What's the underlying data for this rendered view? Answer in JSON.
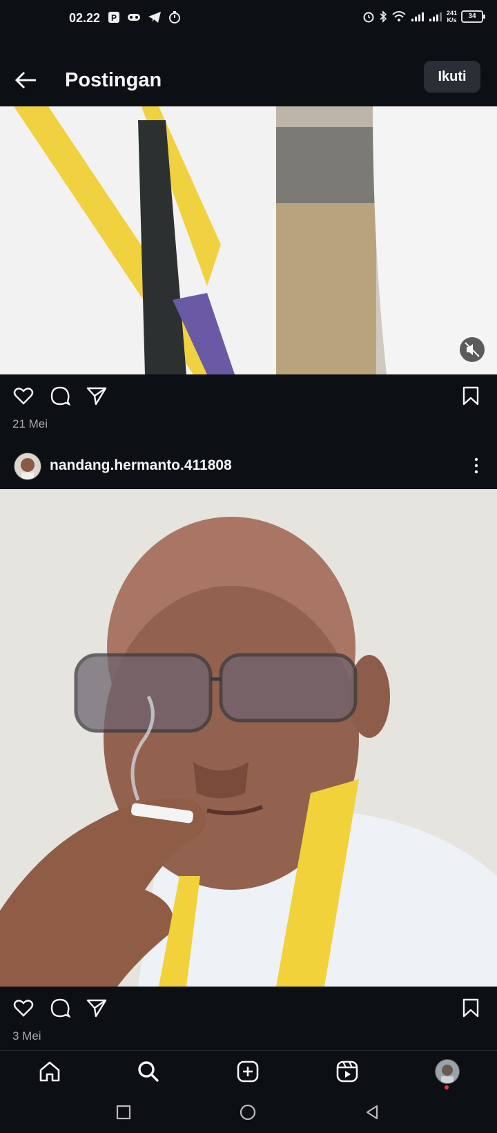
{
  "status_bar": {
    "time": "02.22",
    "net_speed_value": "241",
    "net_speed_unit": "K/s",
    "battery": "34",
    "left_icons": [
      "p-badge-icon",
      "gamepad-icon",
      "telegram-icon",
      "timer-icon"
    ],
    "right_icons": [
      "alarm-icon",
      "bluetooth-icon",
      "wifi-icon",
      "signal-icon",
      "signal-icon"
    ]
  },
  "header": {
    "title": "Postingan",
    "follow_label": "Ikuti"
  },
  "posts": [
    {
      "media_type": "video",
      "muted": true,
      "date": "21 Mei"
    },
    {
      "username": "nandang.hermanto.411808",
      "media_type": "photo",
      "date": "3 Mei"
    }
  ],
  "actions": [
    "like-icon",
    "comment-icon",
    "share-icon",
    "save-icon"
  ],
  "bottom_nav": [
    "home-icon",
    "search-icon",
    "create-icon",
    "reels-icon",
    "profile-avatar"
  ],
  "system_nav": [
    "recents-icon",
    "home-circle-icon",
    "back-triangle-icon"
  ],
  "colors": {
    "background": "#0c1014",
    "button_bg": "#2a2f35",
    "secondary_text": "#a8a8a8",
    "notification_dot": "#ff3040"
  }
}
